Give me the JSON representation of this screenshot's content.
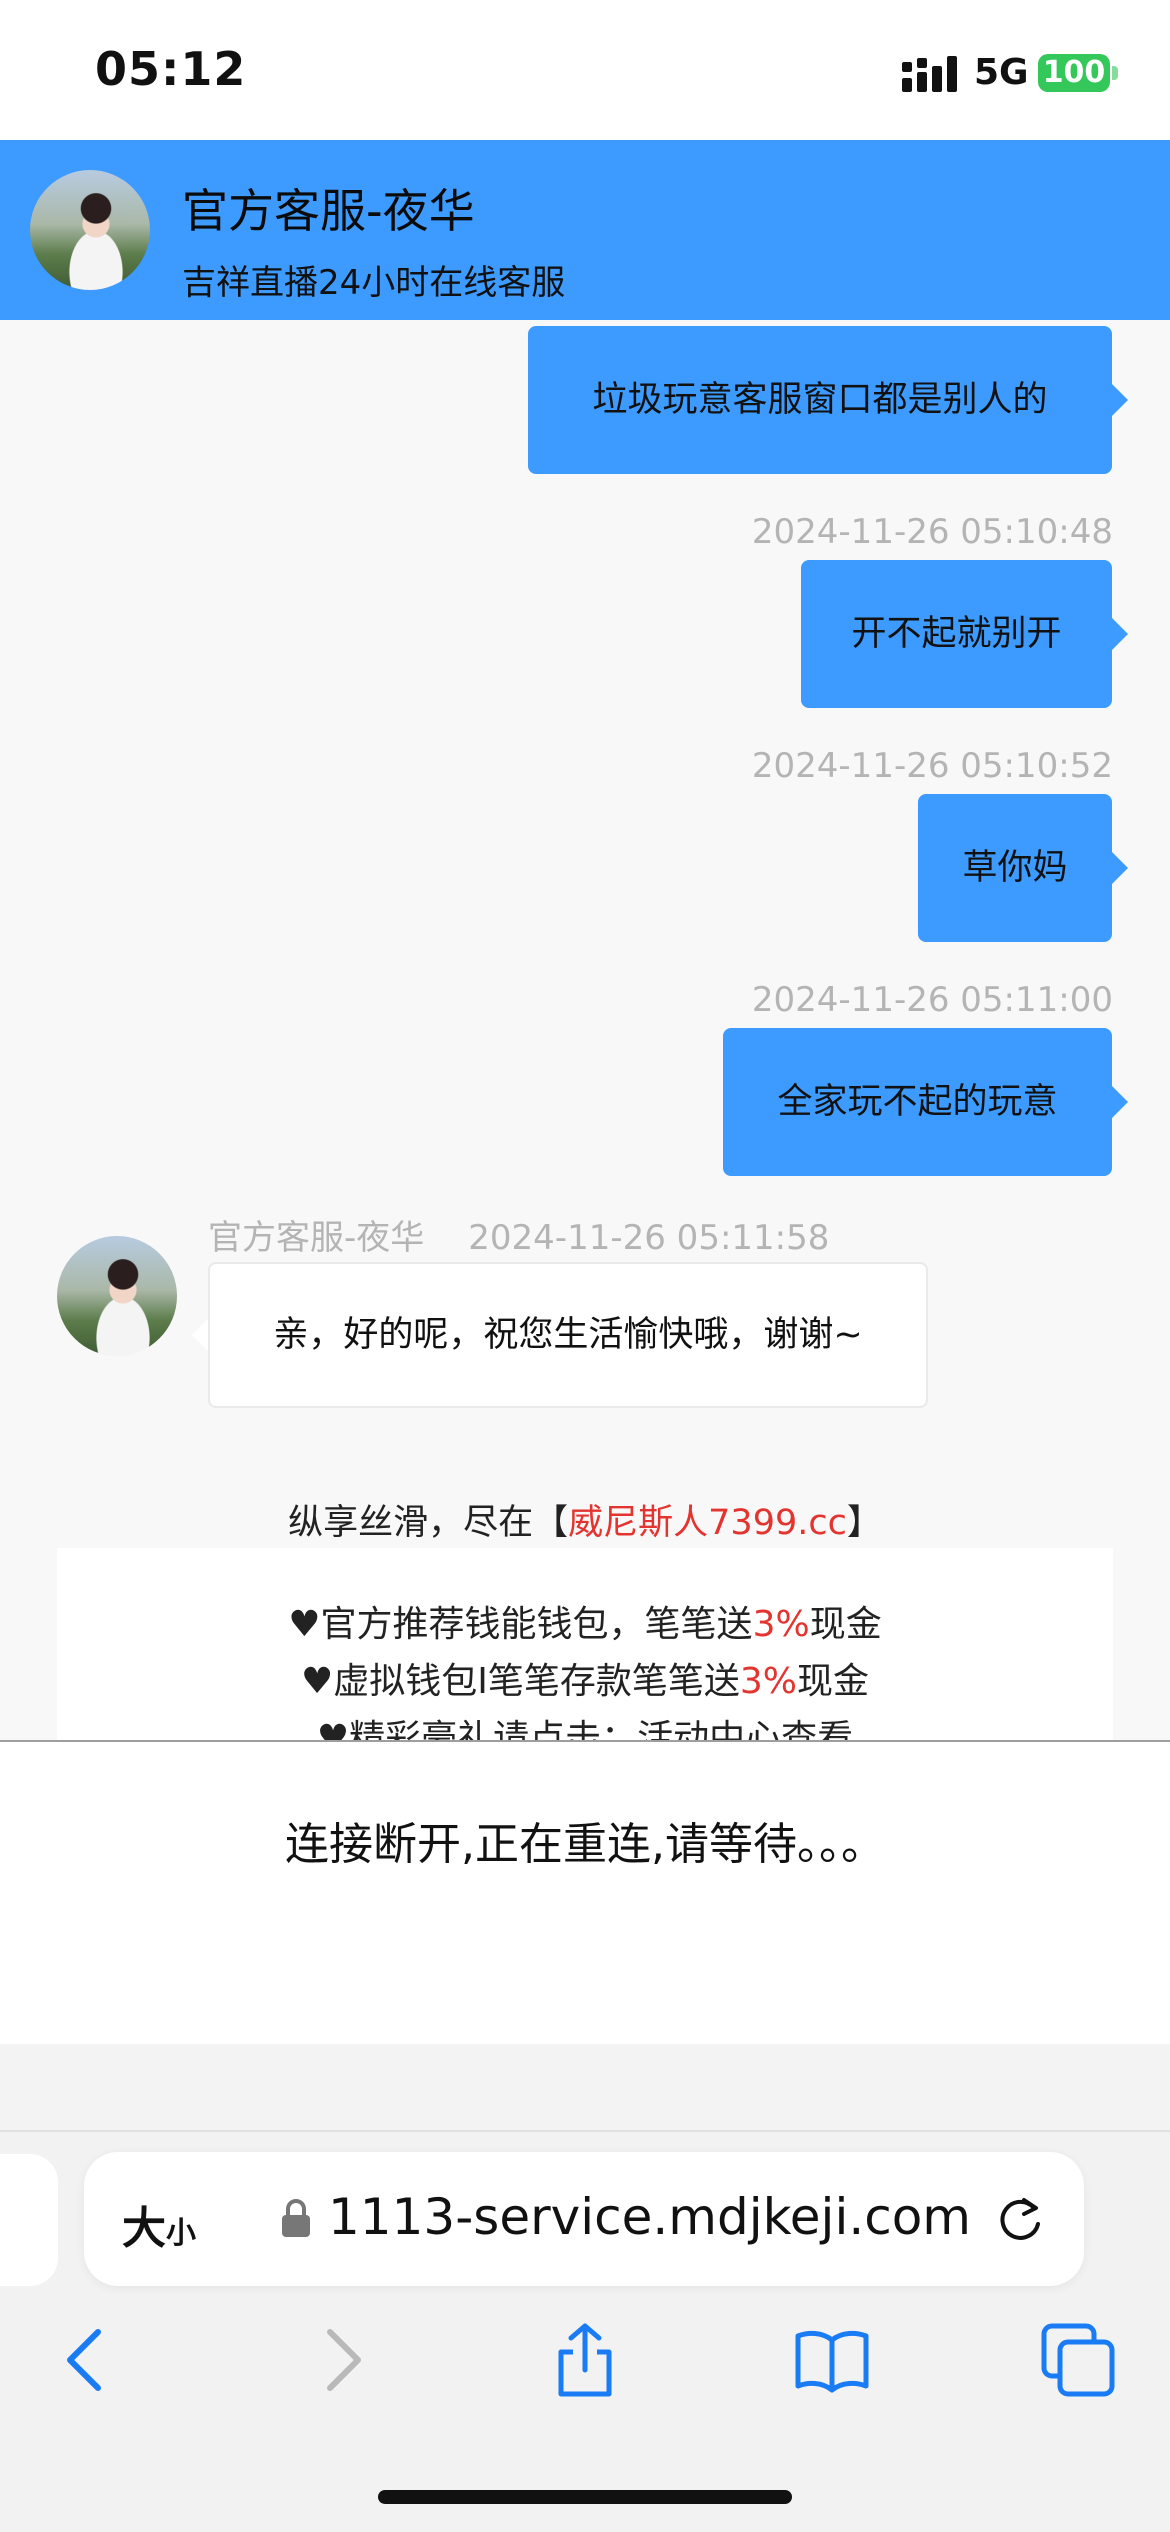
{
  "status_bar": {
    "time": "05:12",
    "network": "5G",
    "battery": "100"
  },
  "header": {
    "title": "官方客服-夜华",
    "subtitle": "吉祥直播24小时在线客服"
  },
  "messages": [
    {
      "text": "垃圾玩意客服窗口都是别人的"
    },
    {
      "timestamp": "2024-11-26 05:10:48",
      "text": "开不起就别开"
    },
    {
      "timestamp": "2024-11-26 05:10:52",
      "text": "草你妈"
    },
    {
      "timestamp": "2024-11-26 05:11:00",
      "text": "全家玩不起的玩意"
    }
  ],
  "incoming": {
    "sender": "官方客服-夜华",
    "timestamp": "2024-11-26 05:11:58",
    "text": "亲，好的呢，祝您生活愉快哦，谢谢~"
  },
  "promo": {
    "head_prefix": "纵享丝滑，尽在【",
    "head_highlight": "威尼斯人7399.cc",
    "head_suffix": "】",
    "line1_prefix": "♥官方推荐钱能钱包，笔笔送",
    "line1_highlight": "3%",
    "line1_suffix": "现金",
    "line2_prefix": "♥虚拟钱包I笔笔存款笔笔送",
    "line2_highlight": "3%",
    "line2_suffix": "现金",
    "line3": "♥精彩豪礼请点击：活动中心查看"
  },
  "overlay": {
    "message": "连接断开,正在重连,请等待。。。"
  },
  "browser": {
    "text_size_big": "大",
    "text_size_small": "小",
    "url": "1113-service.mdjkeji.com"
  },
  "colors": {
    "accent": "#3d9bff",
    "highlight_red": "#e3342f",
    "battery": "#34c759",
    "toolbar_icon": "#1a7cf5"
  },
  "icons": [
    "signal-icon",
    "battery-icon",
    "lock-icon",
    "reload-icon",
    "back-icon",
    "forward-icon",
    "share-icon",
    "bookmarks-icon",
    "tabs-icon"
  ]
}
